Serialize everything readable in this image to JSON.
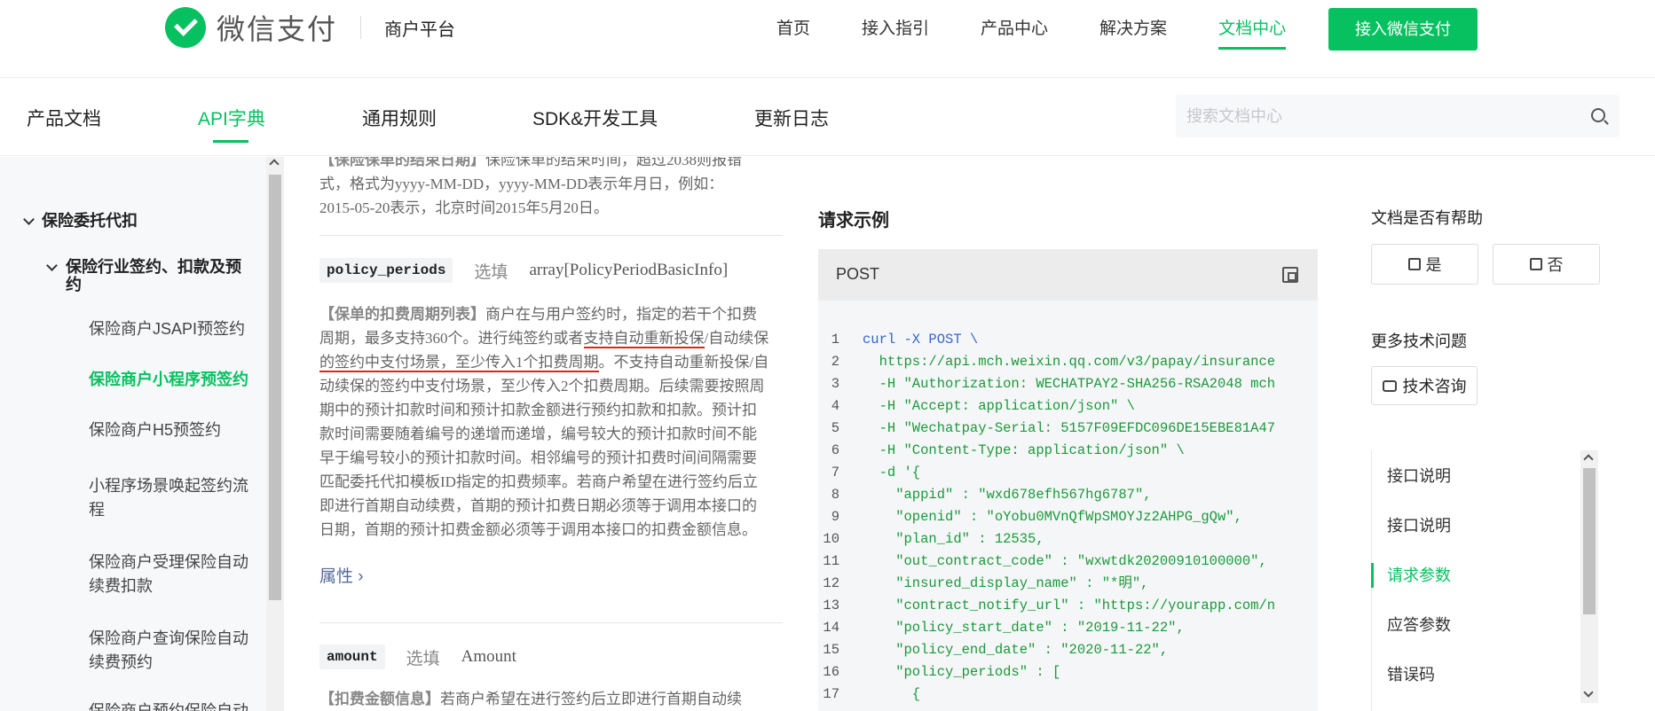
{
  "header": {
    "brand": "微信支付",
    "subtitle": "商户平台",
    "nav": [
      "首页",
      "接入指引",
      "产品中心",
      "解决方案",
      "文档中心"
    ],
    "active_nav": "文档中心",
    "cta": "接入微信支付"
  },
  "subnav": {
    "tabs": [
      "产品文档",
      "API字典",
      "通用规则",
      "SDK&开发工具",
      "更新日志"
    ],
    "active": "API字典",
    "search_placeholder": "搜索文档中心"
  },
  "sidebar": {
    "section": "保险委托代扣",
    "subsection": "保险行业签约、扣款及预约",
    "items": [
      "保险商户JSAPI预签约",
      "保险商户小程序预签约",
      "保险商户H5预签约",
      "小程序场景唤起签约流程",
      "保险商户受理保险自动续费扣款",
      "保险商户查询保险自动续费预约",
      "保险商户预约保险自动"
    ],
    "active_item": "保险商户小程序预签约"
  },
  "content": {
    "intro_b": "【保险保单的结束日期】",
    "intro_text": "保险保单的结束时间，超过2038则报错",
    "intro_line2": "式，格式为yyyy-MM-DD，yyyy-MM-DD表示年月日，例如：",
    "intro_line3": "2015-05-20表示，北京时间2015年5月20日。",
    "param1": {
      "name": "policy_periods",
      "required": "选填",
      "type": "array[PolicyPeriodBasicInfo]",
      "desc_b": "【保单的扣费周期列表】",
      "desc_1": "商户在与用户签约时，指定的若干个扣费",
      "desc_2": "周期，最多支持360个。进行纯签约或者",
      "desc_2u": "支持自动重新投保",
      "desc_2e": "/自动续保",
      "desc_3u": "的签约中支付场景，至少传入1个扣费周期",
      "desc_3e": "。不支持自动重新投保/自",
      "desc_4": "动续保的签约中支付场景，至少传入2个扣费周期。后续需要按照周",
      "desc_5": "期中的预计扣款时间和预计扣款金额进行预约扣款和扣款。预计扣",
      "desc_6": "款时间需要随着编号的递增而递增，编号较大的预计扣款时间不能",
      "desc_7": "早于编号较小的预计扣款时间。相邻编号的预计扣费时间间隔需要",
      "desc_8": "匹配委托代扣模板ID指定的扣费频率。若商户希望在进行签约后立",
      "desc_9": "即进行首期自动续费，首期的预计扣费日期必须等于调用本接口的",
      "desc_10": "日期，首期的预计扣费金额必须等于调用本接口的扣费金额信息。",
      "attr_link": "属性 ›"
    },
    "param2": {
      "name": "amount",
      "required": "选填",
      "type": "Amount",
      "desc_b": "【扣费金额信息】",
      "desc_1": "若商户希望在进行签约后立即进行首期自动续"
    }
  },
  "request": {
    "title": "请求示例",
    "method": "POST",
    "lines": [
      "curl -X POST \\",
      "  https://api.mch.weixin.qq.com/v3/papay/insurance",
      "  -H \"Authorization: WECHATPAY2-SHA256-RSA2048 mch",
      "  -H \"Accept: application/json\" \\",
      "  -H \"Wechatpay-Serial: 5157F09EFDC096DE15EBE81A47",
      "  -H \"Content-Type: application/json\" \\",
      "  -d '{",
      "    \"appid\" : \"wxd678efh567hg6787\",",
      "    \"openid\" : \"oYobu0MVnQfWpSMOYJz2AHPG_gQw\",",
      "    \"plan_id\" : 12535,",
      "    \"out_contract_code\" : \"wxwtdk20200910100000\",",
      "    \"insured_display_name\" : \"*明\",",
      "    \"contract_notify_url\" : \"https://yourapp.com/n",
      "    \"policy_start_date\" : \"2019-11-22\",",
      "    \"policy_end_date\" : \"2020-11-22\",",
      "    \"policy_periods\" : [",
      "      {"
    ]
  },
  "right": {
    "help_title": "文档是否有帮助",
    "yes": "是",
    "no": "否",
    "more_title": "更多技术问题",
    "consult": "技术咨询",
    "toc": [
      "接口说明",
      "接口说明",
      "请求参数",
      "应答参数",
      "错误码"
    ],
    "toc_active": "请求参数"
  },
  "colors": {
    "brand": "#07c160",
    "link": "#576b95",
    "underline": "#e2231a"
  }
}
